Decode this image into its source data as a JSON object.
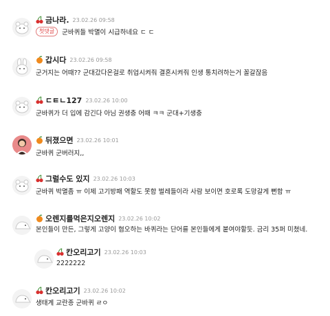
{
  "comments": [
    {
      "badge": "cherry-icon",
      "nick": "금나라.",
      "date": "23.02.26 09:58",
      "first_badge": "첫댓글",
      "text": "군바퀴들 박멸이 시급하네요 ㄷ ㄷ"
    },
    {
      "badge": "orange-icon",
      "nick": "갑시다",
      "date": "23.02.26 09:58",
      "text": "군거지는 어때?? 군대갔다온걸로 취업시켜줘 결혼시켜줘 인생 통치려하는거 꼴갈잖음"
    },
    {
      "badge": "cherry-icon",
      "nick": "ㄷㅌㄴ127",
      "date": "23.02.26 10:00",
      "text": "군바퀴가 더 입에 감긴다 아님 권생충 어때 ㅋㅋ 군대+기생충"
    },
    {
      "badge": "orange-icon",
      "nick": "뒤졌으면",
      "date": "23.02.26 10:01",
      "text": "군바퀴 군버러지,,"
    },
    {
      "badge": "cherry-icon",
      "nick": "그럴수도 있지",
      "date": "23.02.26 10:03",
      "text": "군바퀴 박멸좀 ㅠ 이제 고기방패 역할도 못함 벌레들이라 사람 보이면 호로록 도망갈게 뻔함 ㅠ"
    },
    {
      "badge": "orange-icon",
      "nick": "오렌지를먹은지오렌지",
      "date": "23.02.26 10:02",
      "text": "본인들이 만든, 그렇게 고양이 혐오하는 바퀴라는 단어를 본인들에게 붙여야할듯. 금리 35퍼 미쳤네."
    },
    {
      "badge": "cherry-icon",
      "nick": "칸오리고기",
      "date": "23.02.26 10:03",
      "text": "2222222"
    },
    {
      "badge": "cherry-icon",
      "nick": "칸오리고기",
      "date": "23.02.26 10:02",
      "text": "생태계 교란종 군바퀴 ㄹㅇ"
    }
  ],
  "colors": {
    "nick": "#222222",
    "date": "#999999",
    "first_badge": "#e04545",
    "cherry": "#d8302f",
    "orange": "#f08a1e"
  }
}
